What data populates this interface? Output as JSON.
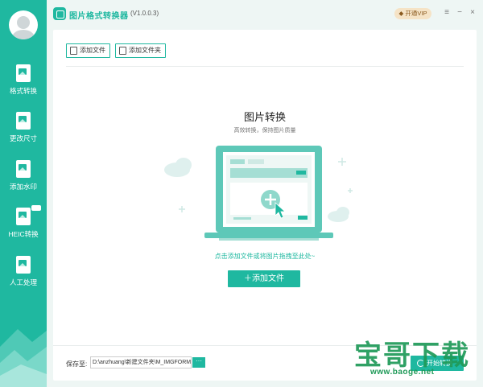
{
  "titlebar": {
    "app_title": "图片格式转换器",
    "version": "(V1.0.0.3)",
    "vip_label": "开通VIP",
    "menu_glyph": "≡",
    "minimize_glyph": "−",
    "close_glyph": "×"
  },
  "sidebar": {
    "items": [
      {
        "label": "格式转换"
      },
      {
        "label": "更改尺寸"
      },
      {
        "label": "添加水印"
      },
      {
        "label": "HEIC转换"
      },
      {
        "label": "人工处理"
      }
    ]
  },
  "toolbar": {
    "add_file": "添加文件",
    "add_folder": "添加文件夹"
  },
  "main": {
    "heading": "图片转换",
    "subheading": "高效转换，保持图片质量",
    "hint": "点击添加文件或将图片拖拽至此处~",
    "add_button": "＋添加文件"
  },
  "footer": {
    "save_label": "保存至:",
    "save_path": "D:\\anzhuang\\新建文件夹\\M_IMGFORM",
    "browse_label": "···",
    "start_label": "开始转换"
  },
  "watermark": {
    "text": "宝哥下载",
    "url": "www.baoge.net"
  },
  "colors": {
    "accent": "#1fb8a0",
    "vip_bg": "#f5e3c6",
    "watermark": "#1f9a58"
  }
}
